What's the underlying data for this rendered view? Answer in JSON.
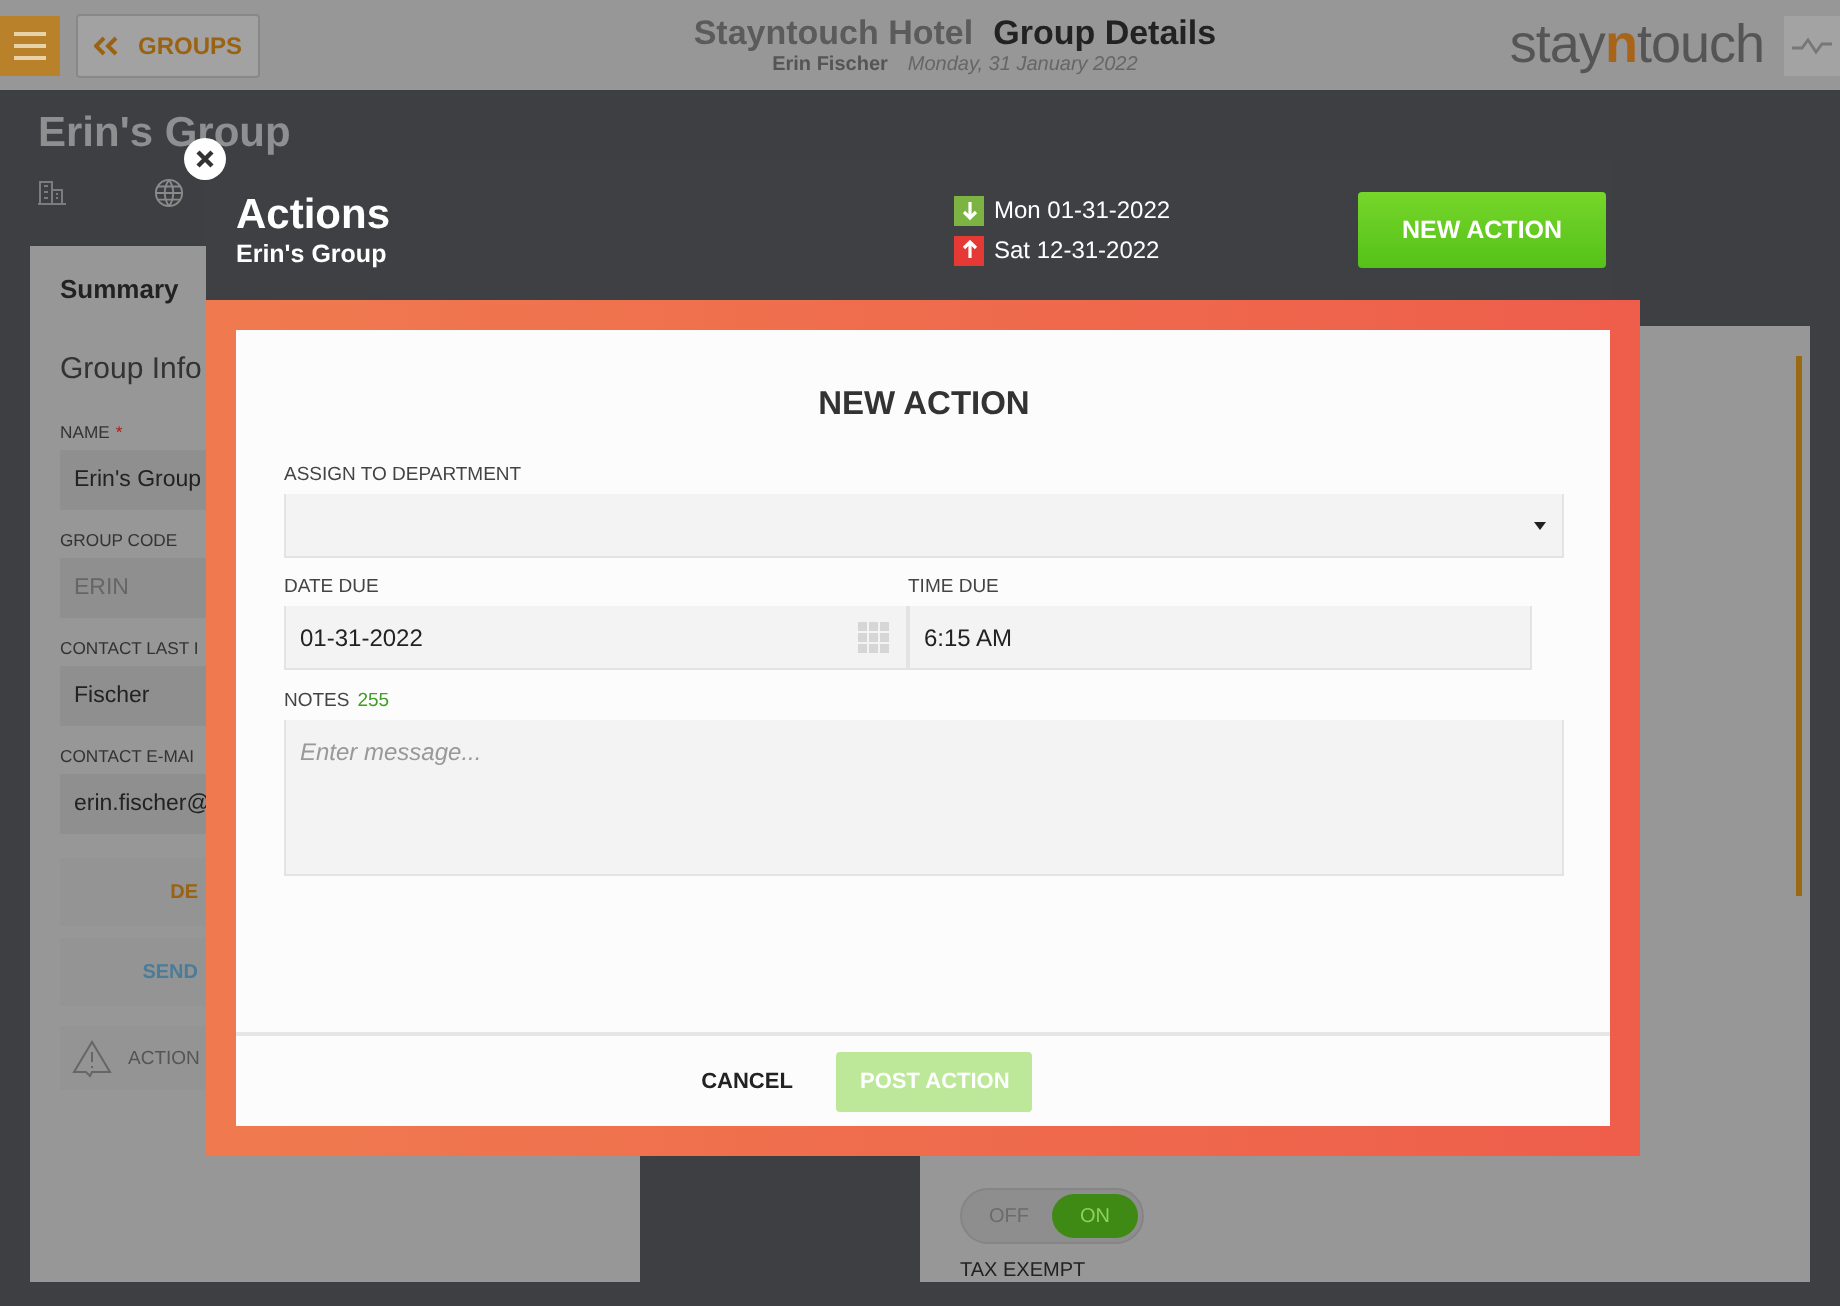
{
  "header": {
    "back_label": "GROUPS",
    "hotel": "Stayntouch Hotel",
    "page_title": "Group Details",
    "user": "Erin Fischer",
    "date": "Monday, 31 January 2022",
    "logo": {
      "before": "stay",
      "accent": "n",
      "after": "touch"
    }
  },
  "page": {
    "title": "Erin's Group"
  },
  "summary": {
    "tab": "Summary",
    "section": "Group Info",
    "fields": [
      {
        "label": "NAME",
        "required_mark": "*",
        "value": "Erin's Group",
        "disabled": false
      },
      {
        "label": "GROUP CODE",
        "value": "ERIN",
        "disabled": true
      },
      {
        "label": "CONTACT LAST I",
        "value": "Fischer",
        "disabled": false
      },
      {
        "label": "CONTACT E-MAI",
        "value": "erin.fischer@",
        "disabled": false
      }
    ],
    "buttons": [
      {
        "label": "DE",
        "kind": "orange"
      },
      {
        "label": "SEND",
        "kind": "blue"
      }
    ],
    "actions_label": "ACTION"
  },
  "side": {
    "toggle": {
      "off_label": "OFF",
      "on_label": "ON",
      "on": true
    },
    "tax_label": "TAX EXEMPT"
  },
  "modal": {
    "title": "Actions",
    "subtitle": "Erin's Group",
    "dates": [
      {
        "kind": "arrival",
        "text": "Mon 01-31-2022",
        "color": "#7cb342"
      },
      {
        "kind": "departure",
        "text": "Sat 12-31-2022",
        "color": "#e53935"
      }
    ],
    "new_button": "NEW ACTION",
    "form": {
      "title": "NEW ACTION",
      "department_label": "ASSIGN TO DEPARTMENT",
      "date_label": "DATE DUE",
      "date_value": "01-31-2022",
      "time_label": "TIME DUE",
      "time_value": "6:15 AM",
      "notes_label": "NOTES",
      "notes_count": "255",
      "notes_placeholder": "Enter message...",
      "cancel": "CANCEL",
      "post": "POST ACTION",
      "post_disabled": true
    }
  }
}
